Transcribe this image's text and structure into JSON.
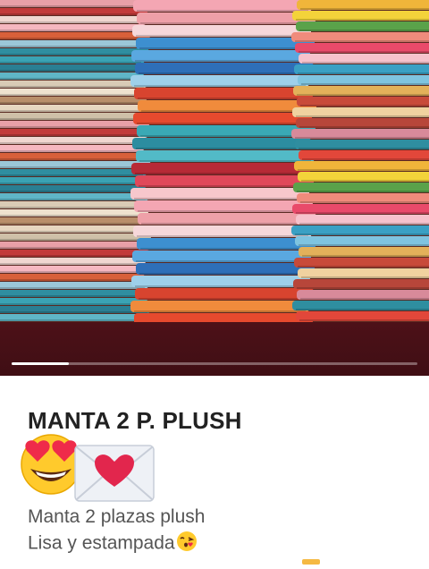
{
  "product": {
    "title": "MANTA 2 P. PLUSH",
    "title_emojis": [
      "smiling-face-with-heart-eyes",
      "love-letter"
    ],
    "description_line1": "Manta 2 plazas plush",
    "description_line2": "Lisa y estampada",
    "description_line2_emoji": "face-blowing-a-kiss"
  },
  "gallery": {
    "progress": 0.14,
    "image_subject": "stacks of folded colorful blankets"
  },
  "colors": {
    "footer_bar": "#4a1017",
    "title_text": "#222222",
    "description_text": "#555555"
  }
}
